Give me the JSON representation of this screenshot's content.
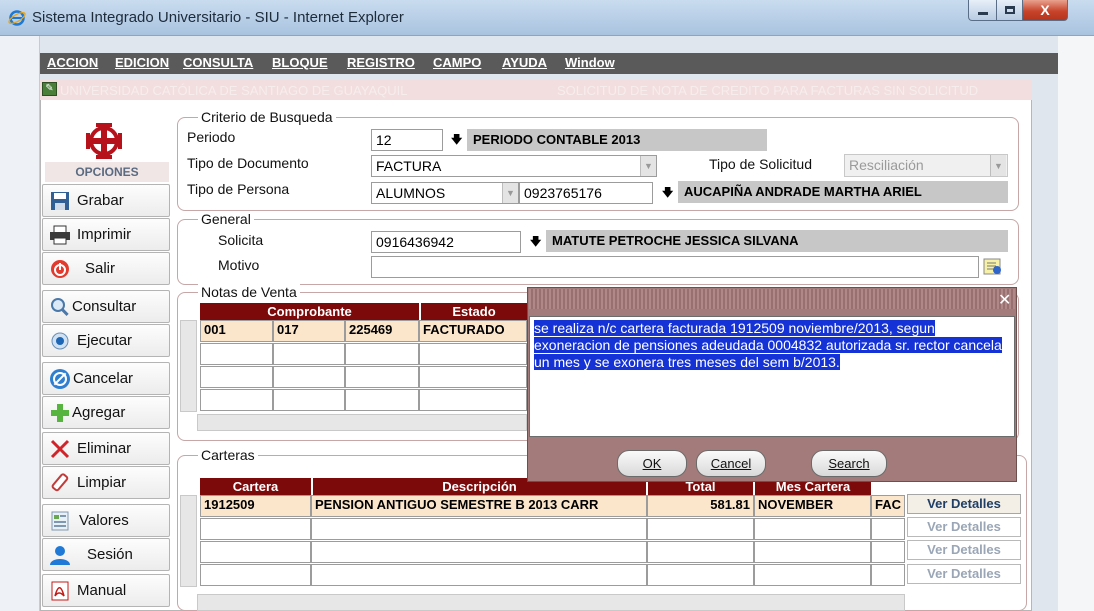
{
  "window": {
    "title": "Sistema Integrado Universitario - SIU - Internet Explorer",
    "close_glyph": "X"
  },
  "menu": [
    "ACCION",
    "EDICION",
    "CONSULTA",
    "BLOQUE",
    "REGISTRO",
    "CAMPO",
    "AYUDA",
    "Window"
  ],
  "header": {
    "university": "UNIVERSIDAD CATÓLICA DE SANTIAGO DE GUAYAQUIL",
    "form_title": "SOLICITUD DE NOTA DE CREDITO PARA FACTURAS SIN SOLICITUD"
  },
  "sidebar": {
    "title": "OPCIONES",
    "buttons": [
      {
        "label": "Grabar",
        "icon": "save-icon"
      },
      {
        "label": "Imprimir",
        "icon": "printer-icon"
      },
      {
        "label": "Salir",
        "icon": "power-icon"
      },
      {
        "label": "Consultar",
        "icon": "magnifier-icon"
      },
      {
        "label": "Ejecutar",
        "icon": "execute-icon"
      },
      {
        "label": "Cancelar",
        "icon": "cancel-icon"
      },
      {
        "label": "Agregar",
        "icon": "plus-icon"
      },
      {
        "label": "Eliminar",
        "icon": "x-icon"
      },
      {
        "label": "Limpiar",
        "icon": "eraser-icon"
      },
      {
        "label": "Valores",
        "icon": "values-icon"
      },
      {
        "label": "Sesión",
        "icon": "user-icon"
      },
      {
        "label": "Manual",
        "icon": "pdf-icon"
      }
    ]
  },
  "criterio": {
    "legend": "Criterio de Busqueda",
    "periodo_label": "Periodo",
    "periodo_value": "12",
    "periodo_desc": "PERIODO CONTABLE 2013",
    "tipo_doc_label": "Tipo de Documento",
    "tipo_doc_value": "FACTURA",
    "tipo_sol_label": "Tipo de Solicitud",
    "tipo_sol_value": "Resciliación",
    "tipo_persona_label": "Tipo de Persona",
    "tipo_persona_value": "ALUMNOS",
    "persona_id": "0923765176",
    "persona_name": "AUCAPIÑA ANDRADE MARTHA ARIEL"
  },
  "general": {
    "legend": "General",
    "solicita_label": "Solicita",
    "solicita_id": "0916436942",
    "solicita_name": "MATUTE PETROCHE JESSICA SILVANA",
    "motivo_label": "Motivo",
    "motivo_value": ""
  },
  "notas": {
    "legend": "Notas de Venta",
    "headers": {
      "comprobante": "Comprobante",
      "estado": "Estado"
    },
    "rows": [
      [
        "001",
        "017",
        "225469",
        "FACTURADO"
      ]
    ]
  },
  "carteras": {
    "legend": "Carteras",
    "headers": {
      "cartera": "Cartera",
      "descripcion": "Descripción",
      "total": "Total",
      "mes": "Mes Cartera"
    },
    "rows": [
      [
        "1912509",
        "PENSION ANTIGUO SEMESTRE B 2013 CARR",
        "581.81",
        "NOVEMBER",
        "FAC"
      ]
    ],
    "detail_label": "Ver Detalles"
  },
  "dialog": {
    "text": "se realiza n/c cartera facturada 1912509 noviembre/2013, segun exoneracion de pensiones adeudada 0004832 autorizada sr. rector cancela un mes y se exonera tres meses del sem b/2013.",
    "ok": "OK",
    "cancel": "Cancel",
    "search": "Search",
    "close": "✕"
  }
}
